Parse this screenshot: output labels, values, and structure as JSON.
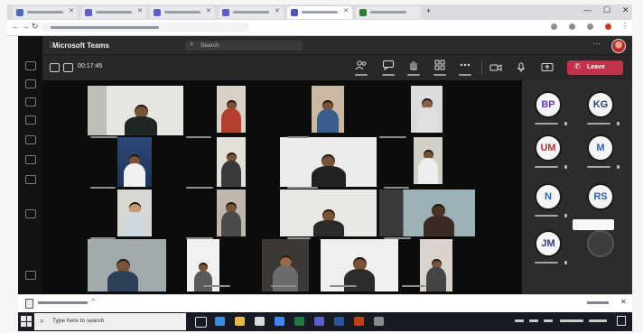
{
  "browser": {
    "window_controls": [
      "minimize-icon",
      "maximize-icon",
      "close-icon"
    ],
    "nav_icons": [
      "back-icon",
      "forward-icon",
      "reload-icon"
    ]
  },
  "teams": {
    "app_title": "Microsoft Teams",
    "search_placeholder": "Search"
  },
  "meeting": {
    "timer": "00:17:45",
    "leave_label": "Leave",
    "toolbar_icons": [
      "people-icon",
      "chat-icon",
      "raise-hand-icon",
      "view-icon",
      "more-icon"
    ],
    "media_icons": [
      "camera-icon",
      "mic-icon",
      "share-screen-icon"
    ]
  },
  "participants": [
    "BP",
    "KG",
    "UM",
    "M",
    "N",
    "RS",
    "JM"
  ],
  "taskbar": {
    "search_placeholder": "Type here to search"
  },
  "colors": {
    "leave_button": "#c4314b",
    "teams_background": "#1b1b1b",
    "taskbar": "#181a24"
  }
}
